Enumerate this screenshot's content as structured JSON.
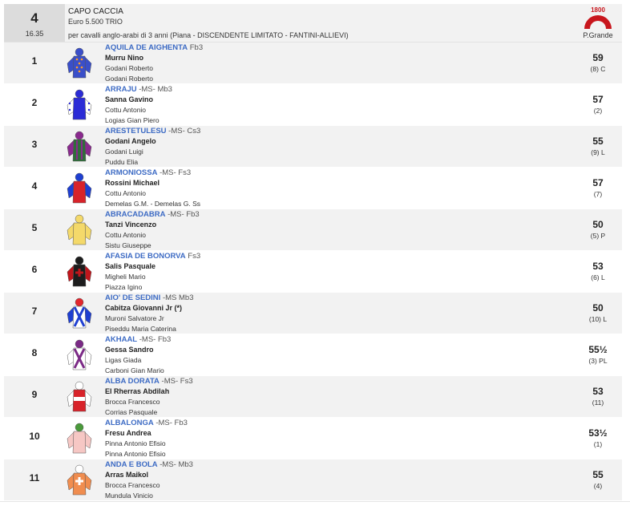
{
  "race": {
    "number": "4",
    "time": "16.35",
    "name": "CAPO CACCIA",
    "prize": "Euro 5.500 TRIO",
    "conditions": "per cavalli anglo-arabi di 3 anni (Piana -  DISCENDENTE LIMITATO  - FANTINI-ALLIEVI)",
    "track_logo_text": "1800",
    "track_name": "P.Grande"
  },
  "runners": [
    {
      "num": "1",
      "horse": "AQUILA DE AIGHENTA",
      "suffix": " Fb3",
      "jockey": "Murru Nino",
      "trainer": "Godani Roberto",
      "owner": "Godani Roberto",
      "weight": "59",
      "post": "(8) C",
      "silk": {
        "body": "#3a4fc9",
        "sleeve": "#3a4fc9",
        "cap": "#3a4fc9",
        "pattern": "dots",
        "pcolor": "#ff9c2a"
      }
    },
    {
      "num": "2",
      "horse": "ARRAJU",
      "suffix": " -MS- Mb3",
      "jockey": "Sanna Gavino",
      "trainer": "Cottu Antonio",
      "owner": "Logias Gian Piero",
      "weight": "57",
      "post": "(2)",
      "silk": {
        "body": "#2b2bd6",
        "sleeve": "#ffffff",
        "cap": "#2b2bd6",
        "pattern": "sleevedots",
        "pcolor": "#2b2bd6"
      }
    },
    {
      "num": "3",
      "horse": "ARESTETULESU",
      "suffix": " -MS- Cs3",
      "jockey": "Godani Angelo",
      "trainer": "Godani Luigi",
      "owner": "Puddu Elia",
      "weight": "55",
      "post": "(9) L",
      "silk": {
        "body": "#2f6e3a",
        "sleeve": "#8a2a8e",
        "cap": "#8a2a8e",
        "pattern": "stripes",
        "pcolor": "#8a2a8e"
      }
    },
    {
      "num": "4",
      "horse": "ARMONIOSSA",
      "suffix": " -MS- Fs3",
      "jockey": "Rossini Michael",
      "trainer": "Cottu Antonio",
      "owner": "Demelas G.M. - Demelas G. Ss",
      "weight": "57",
      "post": "(7)",
      "silk": {
        "body": "#d8232a",
        "sleeve": "#1f3fd1",
        "cap": "#1f3fd1",
        "pattern": "none",
        "pcolor": "#d8232a"
      }
    },
    {
      "num": "5",
      "horse": "ABRACADABRA",
      "suffix": " -MS- Fb3",
      "jockey": "Tanzi Vincenzo",
      "trainer": "Cottu Antonio",
      "owner": "Sistu Giuseppe",
      "weight": "50",
      "post": "(5) P",
      "silk": {
        "body": "#f4d96a",
        "sleeve": "#f4d96a",
        "cap": "#f4d96a",
        "pattern": "none",
        "pcolor": "#f4d96a"
      }
    },
    {
      "num": "6",
      "horse": "AFASIA DE BONORVA",
      "suffix": " Fs3",
      "jockey": "Salis Pasquale",
      "trainer": "Migheli Mario",
      "owner": "Piazza Igino",
      "weight": "53",
      "post": "(6) L",
      "silk": {
        "body": "#1d1d1d",
        "sleeve": "#c0161c",
        "cap": "#1d1d1d",
        "pattern": "cross",
        "pcolor": "#c0161c"
      }
    },
    {
      "num": "7",
      "horse": "AIO' DE SEDINI",
      "suffix": " -MS Mb3",
      "jockey": "Cabitza Giovanni Jr (*)",
      "trainer": "Muroni Salvatore Jr",
      "owner": "Piseddu Maria Caterina",
      "weight": "50",
      "post": "(10) L",
      "silk": {
        "body": "#ffffff",
        "sleeve": "#1f3fd1",
        "cap": "#e2262d",
        "pattern": "crossbelts",
        "pcolor": "#1f3fd1"
      }
    },
    {
      "num": "8",
      "horse": "AKHAAL",
      "suffix": " -MS- Fb3",
      "jockey": "Gessa Sandro",
      "trainer": "Ligas Giada",
      "owner": "Carboni Gian Mario",
      "weight": "55½",
      "post": "(3) PL",
      "silk": {
        "body": "#ffffff",
        "sleeve": "#ffffff",
        "cap": "#7b2a86",
        "pattern": "crossbelts",
        "pcolor": "#7b2a86"
      }
    },
    {
      "num": "9",
      "horse": "ALBA DORATA",
      "suffix": " -MS- Fs3",
      "jockey": "El Rherras Abdilah",
      "trainer": "Brocca Francesco",
      "owner": "Corrias Pasquale",
      "weight": "53",
      "post": "(11)",
      "silk": {
        "body": "#d8232a",
        "sleeve": "#ffffff",
        "cap": "#ffffff",
        "pattern": "band",
        "pcolor": "#ffffff"
      }
    },
    {
      "num": "10",
      "horse": "ALBALONGA",
      "suffix": " -MS- Fb3",
      "jockey": "Fresu Andrea",
      "trainer": "Pinna Antonio Efisio",
      "owner": "Pinna Antonio Efisio",
      "weight": "53½",
      "post": "(1)",
      "silk": {
        "body": "#f6c7c4",
        "sleeve": "#f6c7c4",
        "cap": "#4a9a3b",
        "pattern": "none",
        "pcolor": "#ffffff"
      }
    },
    {
      "num": "11",
      "horse": "ANDA E BOLA",
      "suffix": " -MS- Mb3",
      "jockey": "Arras Maikol",
      "trainer": "Brocca Francesco",
      "owner": "Mundula Vinicio",
      "weight": "55",
      "post": "(4)",
      "silk": {
        "body": "#f08d4f",
        "sleeve": "#f08d4f",
        "cap": "#ffffff",
        "pattern": "cross",
        "pcolor": "#ffffff"
      }
    }
  ]
}
